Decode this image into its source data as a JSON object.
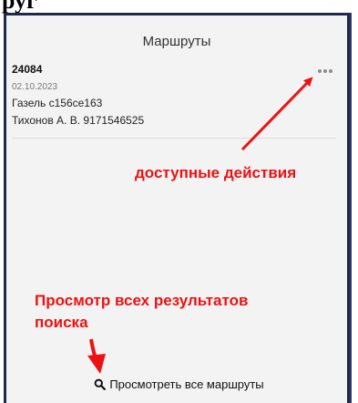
{
  "header_fragment": "руг",
  "panel": {
    "title": "Маршруты"
  },
  "route": {
    "number": "24084",
    "date": "02.10.2023",
    "vehicle": "Газель с156се163",
    "driver": "Тихонов А. В. 9171546525"
  },
  "annotations": {
    "actions": "доступные действия",
    "search_line1": "Просмотр всех результатов",
    "search_line2": "поиска"
  },
  "footer": {
    "view_all_label": "Просмотреть все маршруты"
  },
  "icons": {
    "actions": "more-horizontal-icon",
    "search": "search-icon"
  },
  "colors": {
    "annotation": "#ee1111",
    "panel_border": "#1e2a4a"
  }
}
